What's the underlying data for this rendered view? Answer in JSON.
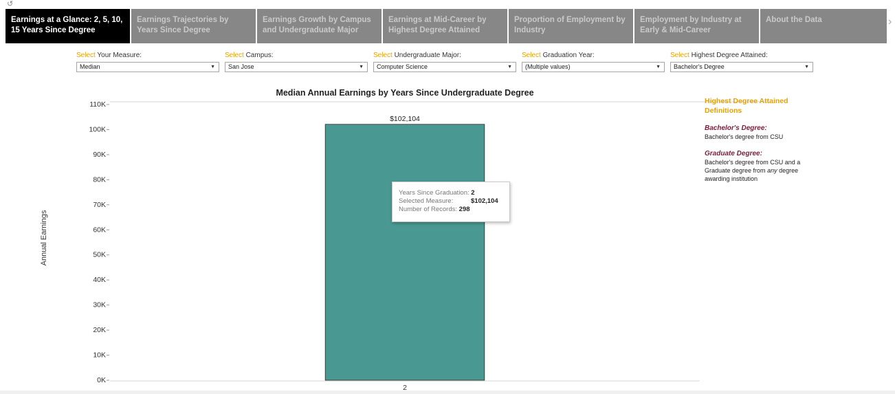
{
  "tabs": [
    {
      "label": "Earnings at a Glance: 2, 5, 10, 15 Years Since Degree",
      "active": true
    },
    {
      "label": "Earnings Trajectories by Years Since Degree",
      "active": false
    },
    {
      "label": "Earnings Growth by Campus and Undergraduate Major",
      "active": false
    },
    {
      "label": "Earnings at Mid-Career by Highest Degree Attained",
      "active": false
    },
    {
      "label": "Proportion of Employment by Industry",
      "active": false
    },
    {
      "label": "Employment by Industry at Early & Mid-Career",
      "active": false
    },
    {
      "label": "About the Data",
      "active": false
    }
  ],
  "icons": {
    "revert": "revert-icon",
    "tab_scroll": "chevron-right-icon",
    "dropdown": "caret-down-icon"
  },
  "filters": [
    {
      "prefix": "Select",
      "label": " Your Measure:",
      "value": "Median"
    },
    {
      "prefix": "Select",
      "label": " Campus:",
      "value": "San Jose"
    },
    {
      "prefix": "Select",
      "label": " Undergraduate Major:",
      "value": "Computer Science"
    },
    {
      "prefix": "Select",
      "label": " Graduation Year:",
      "value": "(Multiple values)"
    },
    {
      "prefix": "Select",
      "label": " Highest Degree Attained:",
      "value": "Bachelor's Degree"
    }
  ],
  "chart_data": {
    "type": "bar",
    "title": "Median Annual Earnings by Years Since Undergraduate Degree",
    "xlabel": "",
    "ylabel": "Annual Earnings",
    "categories": [
      "2"
    ],
    "values": [
      102104
    ],
    "data_labels": [
      "$102,104"
    ],
    "yticks": [
      "0K",
      "10K",
      "20K",
      "30K",
      "40K",
      "50K",
      "60K",
      "70K",
      "80K",
      "90K",
      "100K",
      "110K"
    ],
    "ylim": [
      0,
      110000
    ],
    "bar_color": "#4a9892",
    "grid": false
  },
  "tooltip": {
    "years_label": "Years Since Graduation:",
    "years_value": "2",
    "measure_label": "Selected Measure:",
    "measure_value": "$102,104",
    "records_label": "Number of Records:",
    "records_value": "298"
  },
  "legend": {
    "title": "Highest Degree Attained Definitions",
    "defs": [
      {
        "term": "Bachelor's Degree:",
        "text": "Bachelor's degree from CSU"
      },
      {
        "term": "Graduate Degree:",
        "text_a": "Bachelor's degree from CSU and a Graduate degree from ",
        "text_em": "any",
        "text_b": " degree awarding institution"
      }
    ]
  },
  "colors": {
    "accent": "#e8a100",
    "active_tab": "#000000",
    "inactive_tab": "#878787",
    "definition_term": "#7b1d3a"
  }
}
